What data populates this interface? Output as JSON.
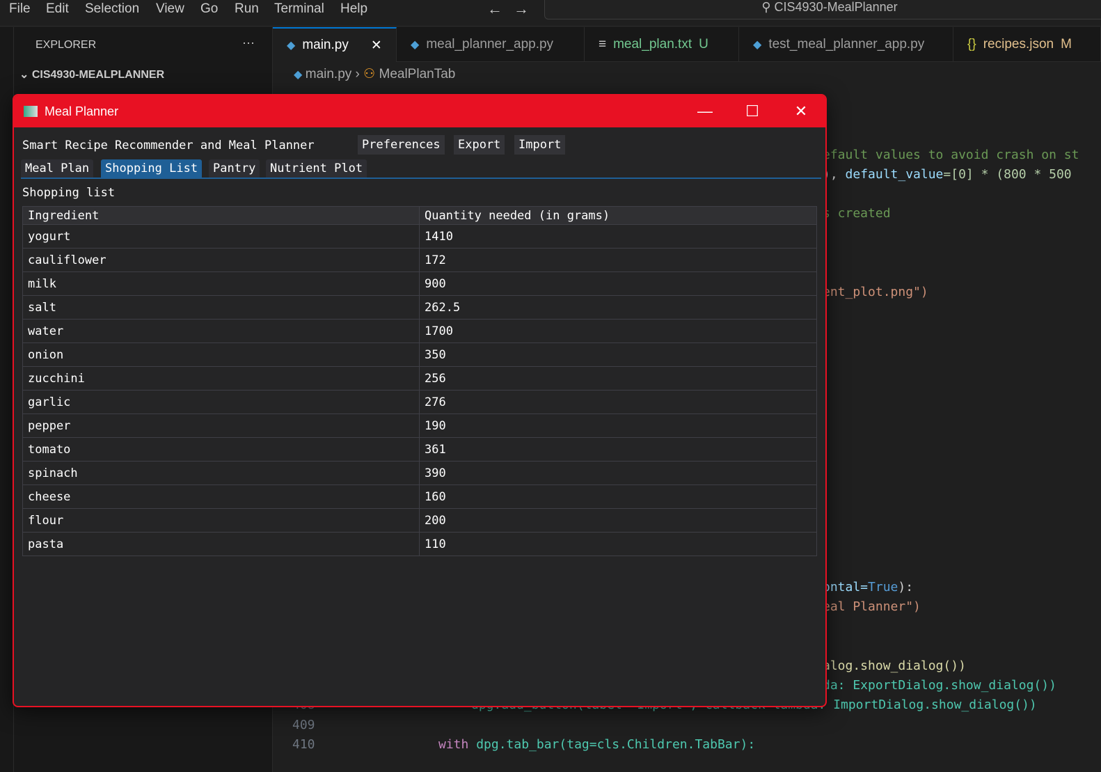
{
  "menubar": {
    "items": [
      "File",
      "Edit",
      "Selection",
      "View",
      "Go",
      "Run",
      "Terminal",
      "Help"
    ],
    "search": "CIS4930-MealPlanner"
  },
  "sidebar": {
    "title": "EXPLORER",
    "more": "···",
    "folder": "CIS4930-MEALPLANNER"
  },
  "tabs": [
    {
      "label": "main.py",
      "icon": "python-icon",
      "active": true,
      "close": "✕"
    },
    {
      "label": "meal_planner_app.py",
      "icon": "python-icon"
    },
    {
      "label": "meal_plan.txt",
      "icon": "text-file-icon",
      "status": "U",
      "color": "#73c991"
    },
    {
      "label": "test_meal_planner_app.py",
      "icon": "python-icon"
    },
    {
      "label": "recipes.json",
      "icon": "json-icon",
      "status": "M",
      "color": "#e2c08d"
    }
  ],
  "breadcrumb": {
    "file": "main.py",
    "symbol": "MealPlanTab"
  },
  "code": {
    "l1": "efault values to avoid crash on st",
    "l2a": "), ",
    "l2b": "default_value",
    "l2c": "=[0] * (800 * 500",
    "l3": "s created",
    "l4": "ent_plot.png\")",
    "l5a": "ontal=",
    "l5b": "True",
    "l5c": "):",
    "l6": "eal Planner\")",
    "l7": "alog.show_dialog())",
    "l8": "da: ExportDialog.show_dialog())",
    "l9": "dpg.add_button(label=\"Import\", callback=lambda: ImportDialog.show_dialog())",
    "n408": "408",
    "n409": "409",
    "n410": "410",
    "l10a": "with ",
    "l10b": "dpg.tab_bar(tag=cls.Children.TabBar):"
  },
  "window": {
    "title": "Meal Planner",
    "accent": "#e81123",
    "app_title": "Smart Recipe Recommender and Meal Planner",
    "buttons": [
      "Preferences",
      "Export",
      "Import"
    ],
    "tabs": [
      "Meal Plan",
      "Shopping List",
      "Pantry",
      "Nutrient Plot"
    ],
    "selected_tab": "Shopping List",
    "section_label": "Shopping list",
    "table": {
      "headers": [
        "Ingredient",
        "Quantity needed (in grams)"
      ],
      "rows": [
        [
          "yogurt",
          "1410"
        ],
        [
          "cauliflower",
          "172"
        ],
        [
          "milk",
          "900"
        ],
        [
          "salt",
          "262.5"
        ],
        [
          "water",
          "1700"
        ],
        [
          "onion",
          "350"
        ],
        [
          "zucchini",
          "256"
        ],
        [
          "garlic",
          "276"
        ],
        [
          "pepper",
          "190"
        ],
        [
          "tomato",
          "361"
        ],
        [
          "spinach",
          "390"
        ],
        [
          "cheese",
          "160"
        ],
        [
          "flour",
          "200"
        ],
        [
          "pasta",
          "110"
        ]
      ]
    }
  }
}
